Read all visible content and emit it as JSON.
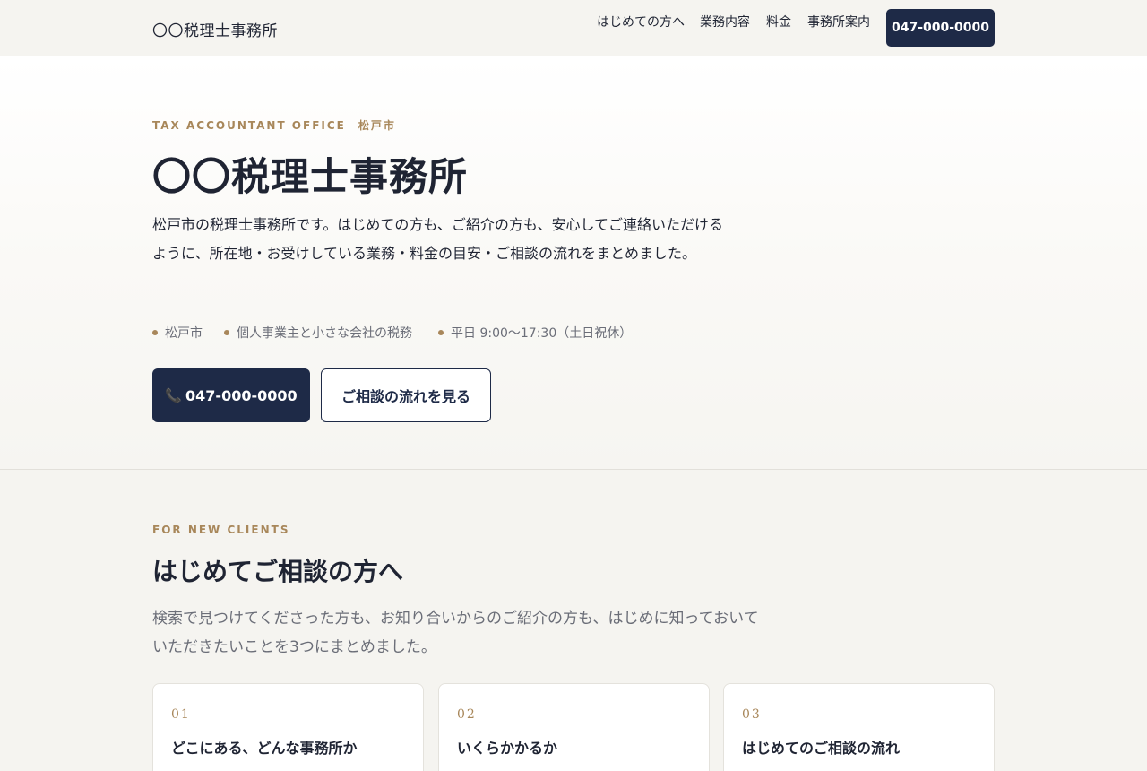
{
  "header": {
    "logo": "〇〇税理士事務所",
    "nav": [
      {
        "label": "はじめての方へ"
      },
      {
        "label": "業務内容"
      },
      {
        "label": "料金"
      },
      {
        "label": "事務所案内"
      }
    ],
    "tel_button": "047-000-0000"
  },
  "hero": {
    "eyebrow": "TAX ACCOUNTANT OFFICE　松戸市",
    "title": "〇〇税理士事務所",
    "description": "松戸市の税理士事務所です。はじめての方も、ご紹介の方も、安心してご連絡いただけるように、所在地・お受けしている業務・料金の目安・ご相談の流れをまとめました。",
    "tags": [
      {
        "label": "松戸市"
      },
      {
        "label": "個人事業主と小さな会社の税務"
      },
      {
        "label": "平日 9:00〜17:30（土日祝休）"
      }
    ],
    "primary_button": {
      "icon": "phone-icon",
      "label": "047-000-0000"
    },
    "secondary_button": "ご相談の流れを見る"
  },
  "section": {
    "eyebrow": "FOR NEW CLIENTS",
    "title": "はじめてご相談の方へ",
    "description": "検索で見つけてくださった方も、お知り合いからのご紹介の方も、はじめに知っておいていただきたいことを3つにまとめました。",
    "cards": [
      {
        "num": "01",
        "title": "どこにある、どんな事務所か"
      },
      {
        "num": "02",
        "title": "いくらかかるか"
      },
      {
        "num": "03",
        "title": "はじめてのご相談の流れ"
      }
    ]
  },
  "colors": {
    "navy": "#1e2a47",
    "gold": "#a8875a",
    "background": "#f5f4f0"
  }
}
